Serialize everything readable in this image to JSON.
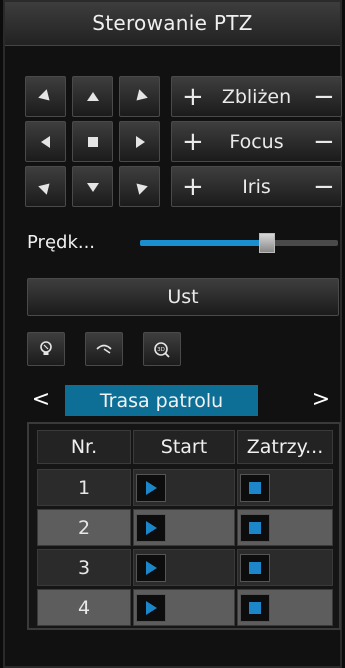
{
  "panel": {
    "title": "Sterowanie PTZ"
  },
  "direction_pad": {
    "buttons": [
      "up-left",
      "up",
      "up-right",
      "left",
      "stop",
      "right",
      "down-left",
      "down",
      "down-right"
    ]
  },
  "lens_controls": [
    {
      "label": "Zbliżen",
      "plus": "+",
      "minus": "−"
    },
    {
      "label": "Focus",
      "plus": "+",
      "minus": "−"
    },
    {
      "label": "Iris",
      "plus": "+",
      "minus": "−"
    }
  ],
  "speed": {
    "label": "Prędk...",
    "value_fraction": 0.64
  },
  "set_button": {
    "label": "Ust"
  },
  "tool_icons": [
    "light-icon",
    "wiper-icon",
    "3d-positioning-icon"
  ],
  "tabs": {
    "prev": "<",
    "next": ">",
    "active_label": "Trasa patrolu"
  },
  "patrol_table": {
    "headers": [
      "Nr.",
      "Start",
      "Zatrzy..."
    ],
    "rows": [
      {
        "nr": "1"
      },
      {
        "nr": "2"
      },
      {
        "nr": "3"
      },
      {
        "nr": "4"
      }
    ]
  },
  "colors": {
    "accent": "#1a8fd0",
    "tab_active": "#0e6f96",
    "stop_square": "#1b86c9"
  }
}
